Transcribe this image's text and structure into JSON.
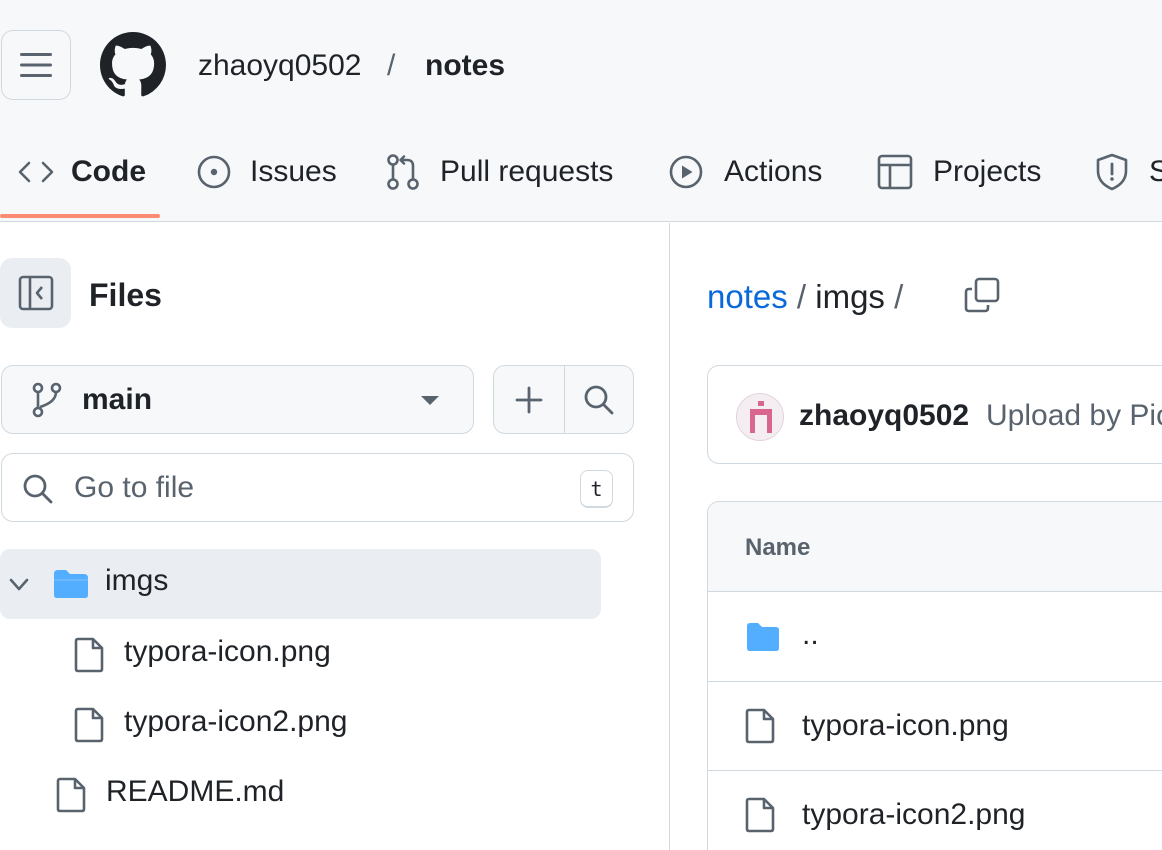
{
  "header": {
    "owner": "zhaoyq0502",
    "separator": "/",
    "repo": "notes"
  },
  "tabs": [
    {
      "label": "Code",
      "icon": "code-icon",
      "active": true
    },
    {
      "label": "Issues",
      "icon": "issue-opened-icon"
    },
    {
      "label": "Pull requests",
      "icon": "pull-request-icon"
    },
    {
      "label": "Actions",
      "icon": "play-icon"
    },
    {
      "label": "Projects",
      "icon": "table-icon"
    },
    {
      "label": "S",
      "icon": "shield-icon"
    }
  ],
  "sidebar": {
    "title": "Files",
    "branch": "main",
    "search_placeholder": "Go to file",
    "search_shortcut": "t",
    "tree": [
      {
        "label": "imgs",
        "type": "folder",
        "expanded": true
      },
      {
        "label": "typora-icon.png",
        "type": "file"
      },
      {
        "label": "typora-icon2.png",
        "type": "file"
      },
      {
        "label": "README.md",
        "type": "file"
      }
    ]
  },
  "main": {
    "path": {
      "root": "notes",
      "slash": "/",
      "folder": "imgs",
      "trailing": "/"
    },
    "commit": {
      "author": "zhaoyq0502",
      "message": "Upload by Pic"
    },
    "table": {
      "column_name": "Name",
      "rows": [
        {
          "label": "..",
          "type": "parent-folder"
        },
        {
          "label": "typora-icon.png",
          "type": "file"
        },
        {
          "label": "typora-icon2.png",
          "type": "file"
        }
      ]
    }
  },
  "colors": {
    "link": "#0969da",
    "tab_underline": "#fd8c73",
    "folder": "#54aeff",
    "border": "#d1d9e0"
  }
}
